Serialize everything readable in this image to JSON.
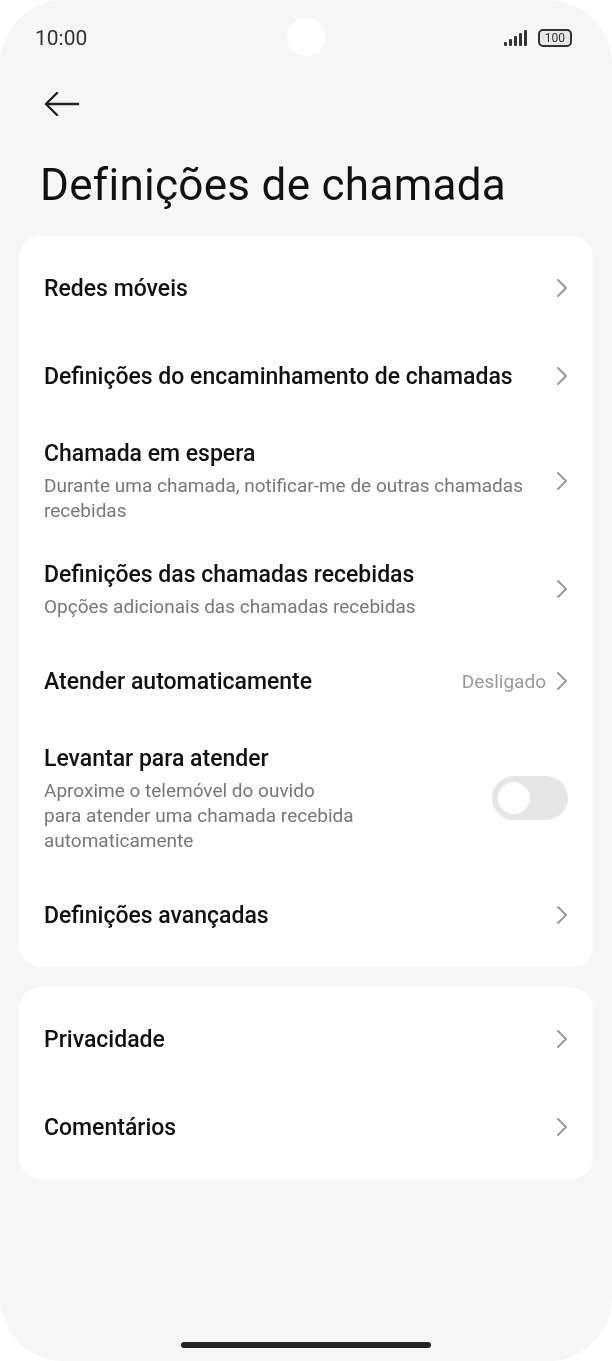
{
  "status_bar": {
    "time": "10:00",
    "battery": "100"
  },
  "title": "Definições de chamada",
  "groups": [
    {
      "items": [
        {
          "kind": "link",
          "label": "Redes móveis"
        },
        {
          "kind": "link",
          "label": "Definições do encaminhamento de chamadas"
        },
        {
          "kind": "link",
          "label": "Chamada em espera",
          "description": "Durante uma chamada, notificar-me de outras chamadas recebidas"
        },
        {
          "kind": "link",
          "label": "Definições das chamadas recebidas",
          "description": "Opções adicionais das chamadas recebidas"
        },
        {
          "kind": "link",
          "label": "Atender automaticamente",
          "value": "Desligado"
        },
        {
          "kind": "toggle",
          "label": "Levantar para atender",
          "description": "Aproxime o telemóvel do ouvido\npara atender uma chamada recebida automaticamente",
          "on": false
        },
        {
          "kind": "link",
          "label": "Definições avançadas"
        }
      ]
    },
    {
      "items": [
        {
          "kind": "link",
          "label": "Privacidade"
        },
        {
          "kind": "link",
          "label": "Comentários"
        }
      ]
    }
  ]
}
